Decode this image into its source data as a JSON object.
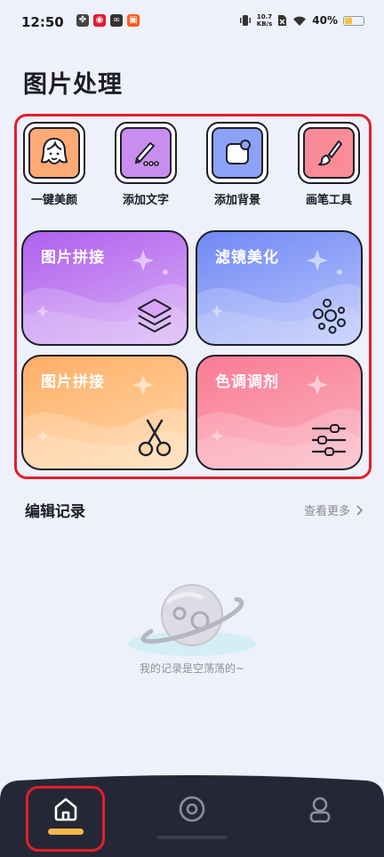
{
  "status_bar": {
    "time": "12:50",
    "notif_icons": [
      {
        "name": "pinwheel-icon",
        "color": "#444444",
        "glyph": "✤"
      },
      {
        "name": "weibo-icon",
        "color": "#e6162d",
        "glyph": "◉"
      },
      {
        "name": "link-app-icon",
        "color": "#333333",
        "glyph": "∞"
      },
      {
        "name": "red-app-icon",
        "color": "#ff5a1f",
        "glyph": "▣"
      }
    ],
    "net_speed_value": "10.7",
    "net_speed_unit": "KB/s",
    "battery_pct": "40%",
    "battery_level": 0.4
  },
  "page_title": "图片处理",
  "tools": [
    {
      "label": "一键美颜",
      "icon": "face-beauty-icon",
      "color": "#ffaa75"
    },
    {
      "label": "添加文字",
      "icon": "pen-text-icon",
      "color": "#c98df0"
    },
    {
      "label": "添加背景",
      "icon": "background-icon",
      "color": "#8ca2f7"
    },
    {
      "label": "画笔工具",
      "icon": "brush-icon",
      "color": "#fa8c98"
    }
  ],
  "cards": [
    {
      "title": "图片拼接",
      "icon": "layers-icon",
      "top_color": "#b160ee",
      "bottom_color": "#d7b0f5"
    },
    {
      "title": "滤镜美化",
      "icon": "filter-dots-icon",
      "top_color": "#7189f5",
      "bottom_color": "#b9c5fb"
    },
    {
      "title": "图片拼接",
      "icon": "scissors-icon",
      "top_color": "#ffae67",
      "bottom_color": "#ffd8a8"
    },
    {
      "title": "色调调剂",
      "icon": "sliders-icon",
      "top_color": "#f97b93",
      "bottom_color": "#fbb3c0"
    }
  ],
  "history": {
    "title": "编辑记录",
    "more_label": "查看更多",
    "empty_text": "我的记录是空荡荡的~"
  },
  "nav": {
    "items": [
      {
        "name": "home",
        "icon": "home-icon",
        "active": true
      },
      {
        "name": "camera",
        "icon": "camera-icon",
        "active": false
      },
      {
        "name": "profile",
        "icon": "profile-icon",
        "active": false
      }
    ],
    "accent": "#f5b84a",
    "bar_color": "#262736"
  }
}
